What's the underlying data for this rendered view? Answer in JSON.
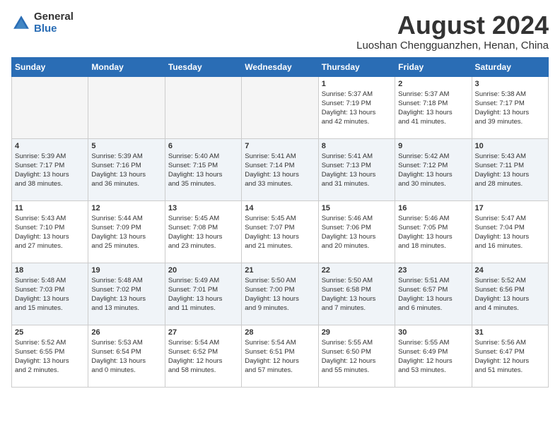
{
  "logo": {
    "general": "General",
    "blue": "Blue"
  },
  "title": "August 2024",
  "location": "Luoshan Chengguanzhen, Henan, China",
  "days_of_week": [
    "Sunday",
    "Monday",
    "Tuesday",
    "Wednesday",
    "Thursday",
    "Friday",
    "Saturday"
  ],
  "weeks": [
    [
      {
        "day": "",
        "info": ""
      },
      {
        "day": "",
        "info": ""
      },
      {
        "day": "",
        "info": ""
      },
      {
        "day": "",
        "info": ""
      },
      {
        "day": "1",
        "info": "Sunrise: 5:37 AM\nSunset: 7:19 PM\nDaylight: 13 hours\nand 42 minutes."
      },
      {
        "day": "2",
        "info": "Sunrise: 5:37 AM\nSunset: 7:18 PM\nDaylight: 13 hours\nand 41 minutes."
      },
      {
        "day": "3",
        "info": "Sunrise: 5:38 AM\nSunset: 7:17 PM\nDaylight: 13 hours\nand 39 minutes."
      }
    ],
    [
      {
        "day": "4",
        "info": "Sunrise: 5:39 AM\nSunset: 7:17 PM\nDaylight: 13 hours\nand 38 minutes."
      },
      {
        "day": "5",
        "info": "Sunrise: 5:39 AM\nSunset: 7:16 PM\nDaylight: 13 hours\nand 36 minutes."
      },
      {
        "day": "6",
        "info": "Sunrise: 5:40 AM\nSunset: 7:15 PM\nDaylight: 13 hours\nand 35 minutes."
      },
      {
        "day": "7",
        "info": "Sunrise: 5:41 AM\nSunset: 7:14 PM\nDaylight: 13 hours\nand 33 minutes."
      },
      {
        "day": "8",
        "info": "Sunrise: 5:41 AM\nSunset: 7:13 PM\nDaylight: 13 hours\nand 31 minutes."
      },
      {
        "day": "9",
        "info": "Sunrise: 5:42 AM\nSunset: 7:12 PM\nDaylight: 13 hours\nand 30 minutes."
      },
      {
        "day": "10",
        "info": "Sunrise: 5:43 AM\nSunset: 7:11 PM\nDaylight: 13 hours\nand 28 minutes."
      }
    ],
    [
      {
        "day": "11",
        "info": "Sunrise: 5:43 AM\nSunset: 7:10 PM\nDaylight: 13 hours\nand 27 minutes."
      },
      {
        "day": "12",
        "info": "Sunrise: 5:44 AM\nSunset: 7:09 PM\nDaylight: 13 hours\nand 25 minutes."
      },
      {
        "day": "13",
        "info": "Sunrise: 5:45 AM\nSunset: 7:08 PM\nDaylight: 13 hours\nand 23 minutes."
      },
      {
        "day": "14",
        "info": "Sunrise: 5:45 AM\nSunset: 7:07 PM\nDaylight: 13 hours\nand 21 minutes."
      },
      {
        "day": "15",
        "info": "Sunrise: 5:46 AM\nSunset: 7:06 PM\nDaylight: 13 hours\nand 20 minutes."
      },
      {
        "day": "16",
        "info": "Sunrise: 5:46 AM\nSunset: 7:05 PM\nDaylight: 13 hours\nand 18 minutes."
      },
      {
        "day": "17",
        "info": "Sunrise: 5:47 AM\nSunset: 7:04 PM\nDaylight: 13 hours\nand 16 minutes."
      }
    ],
    [
      {
        "day": "18",
        "info": "Sunrise: 5:48 AM\nSunset: 7:03 PM\nDaylight: 13 hours\nand 15 minutes."
      },
      {
        "day": "19",
        "info": "Sunrise: 5:48 AM\nSunset: 7:02 PM\nDaylight: 13 hours\nand 13 minutes."
      },
      {
        "day": "20",
        "info": "Sunrise: 5:49 AM\nSunset: 7:01 PM\nDaylight: 13 hours\nand 11 minutes."
      },
      {
        "day": "21",
        "info": "Sunrise: 5:50 AM\nSunset: 7:00 PM\nDaylight: 13 hours\nand 9 minutes."
      },
      {
        "day": "22",
        "info": "Sunrise: 5:50 AM\nSunset: 6:58 PM\nDaylight: 13 hours\nand 7 minutes."
      },
      {
        "day": "23",
        "info": "Sunrise: 5:51 AM\nSunset: 6:57 PM\nDaylight: 13 hours\nand 6 minutes."
      },
      {
        "day": "24",
        "info": "Sunrise: 5:52 AM\nSunset: 6:56 PM\nDaylight: 13 hours\nand 4 minutes."
      }
    ],
    [
      {
        "day": "25",
        "info": "Sunrise: 5:52 AM\nSunset: 6:55 PM\nDaylight: 13 hours\nand 2 minutes."
      },
      {
        "day": "26",
        "info": "Sunrise: 5:53 AM\nSunset: 6:54 PM\nDaylight: 13 hours\nand 0 minutes."
      },
      {
        "day": "27",
        "info": "Sunrise: 5:54 AM\nSunset: 6:52 PM\nDaylight: 12 hours\nand 58 minutes."
      },
      {
        "day": "28",
        "info": "Sunrise: 5:54 AM\nSunset: 6:51 PM\nDaylight: 12 hours\nand 57 minutes."
      },
      {
        "day": "29",
        "info": "Sunrise: 5:55 AM\nSunset: 6:50 PM\nDaylight: 12 hours\nand 55 minutes."
      },
      {
        "day": "30",
        "info": "Sunrise: 5:55 AM\nSunset: 6:49 PM\nDaylight: 12 hours\nand 53 minutes."
      },
      {
        "day": "31",
        "info": "Sunrise: 5:56 AM\nSunset: 6:47 PM\nDaylight: 12 hours\nand 51 minutes."
      }
    ]
  ]
}
